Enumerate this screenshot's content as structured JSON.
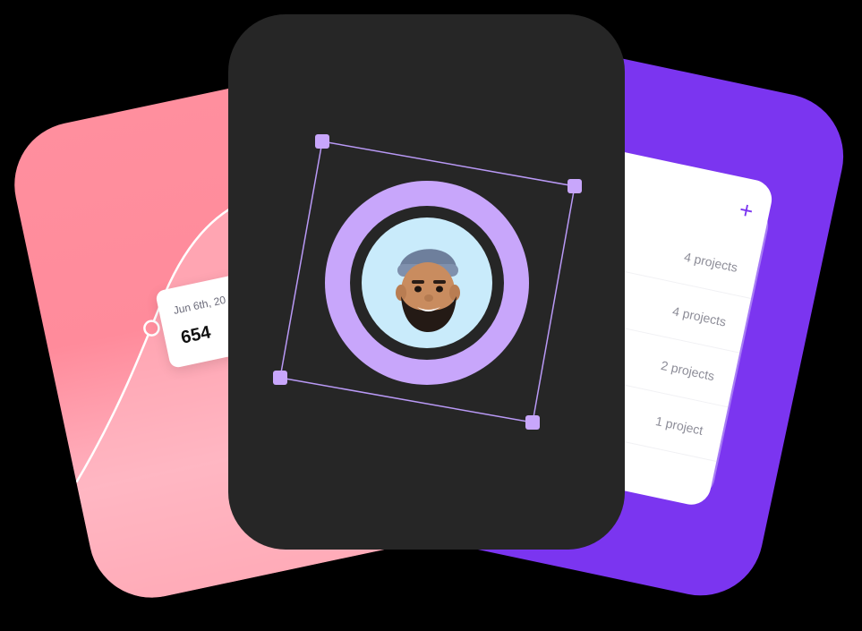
{
  "chart_card": {
    "tooltip": {
      "date": "Jun 6th, 20",
      "value": "654"
    }
  },
  "avatar_card": {
    "avatar_icon": "memoji-avatar-icon",
    "handle_icon": "crop-handle-icon"
  },
  "list_card": {
    "add_icon": "plus-icon",
    "add_label": "+",
    "rows": [
      {
        "label": "4 projects"
      },
      {
        "label": "4 projects"
      },
      {
        "label": "2 projects"
      },
      {
        "label": "1 project"
      }
    ]
  },
  "colors": {
    "pink": "#ff8f9e",
    "purple": "#7b35f0",
    "lavender": "#c8a6fb",
    "dark": "#262626",
    "sky": "#c9ebfb"
  }
}
